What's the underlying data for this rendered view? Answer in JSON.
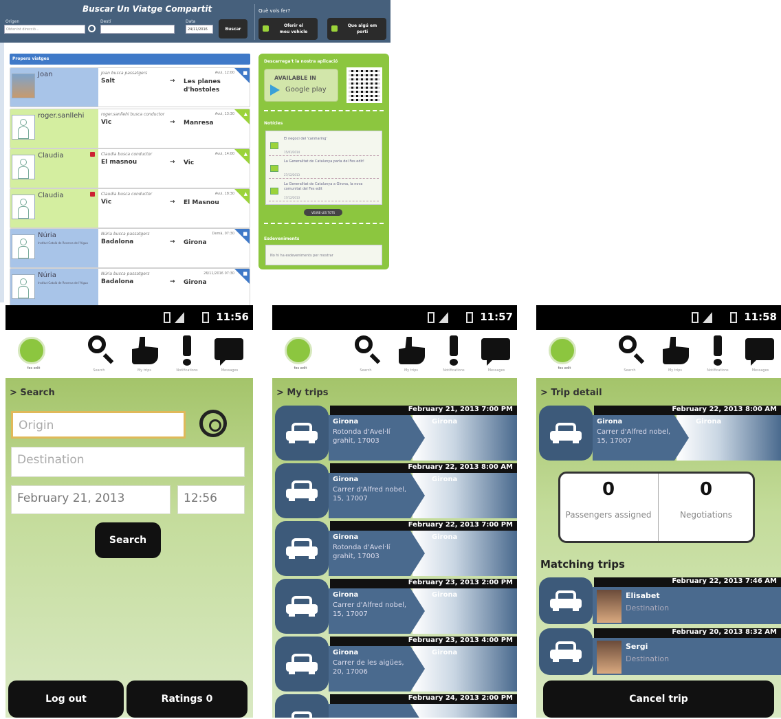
{
  "web": {
    "title": "Buscar Un Viatge Compartit",
    "origin_label": "Origen",
    "origin_placeholder": "Obtenint direcció...",
    "dest_label": "Destí",
    "date_label": "Data",
    "date_value": "24/11/2016",
    "search_button": "Buscar",
    "what_label": "Què vols fer?",
    "offer_button": "Oferir el meu vehicle",
    "want_button": "Que algú em porti",
    "section_title": "Propers viatges",
    "trips": [
      {
        "name": "Joan",
        "org": "",
        "desc": "Joan busca passatgers",
        "when": "Avui, 12:00",
        "from": "Salt",
        "to": "Les planes d'hostoles",
        "color": "blue",
        "badge": false,
        "photo": true
      },
      {
        "name": "roger.sanllehi",
        "org": "",
        "desc": "roger.sanllehi busca conductor",
        "when": "Avui, 13:30",
        "from": "Vic",
        "to": "Manresa",
        "color": "green",
        "badge": false,
        "photo": false
      },
      {
        "name": "Claudia",
        "org": "",
        "desc": "Claudia busca conductor",
        "when": "Avui, 14:00",
        "from": "El masnou",
        "to": "Vic",
        "color": "green",
        "badge": true,
        "photo": false
      },
      {
        "name": "Claudia",
        "org": "",
        "desc": "Claudia busca conductor",
        "when": "Avui, 18:30",
        "from": "Vic",
        "to": "El Masnou",
        "color": "green",
        "badge": true,
        "photo": false
      },
      {
        "name": "Núria",
        "org": "Institut Català de Recerca de l'Aigua",
        "desc": "Núria busca passatgers",
        "when": "Demà, 07:30",
        "from": "Badalona",
        "to": "Girona",
        "color": "blue",
        "badge": false,
        "photo": false
      },
      {
        "name": "Núria",
        "org": "Institut Català de Recerca de l'Aigua",
        "desc": "Núria busca passatgers",
        "when": "26/11/2016 07:30",
        "from": "Badalona",
        "to": "Girona",
        "color": "blue",
        "badge": false,
        "photo": false
      }
    ],
    "arrow": "→",
    "download_title": "Descarrega't la nostra aplicació",
    "gplay_available": "AVAILABLE IN",
    "gplay_name": "Google play",
    "news_title": "Notícies",
    "news": [
      {
        "text": "El negoci del 'carsharing'",
        "date": "15/01/2014"
      },
      {
        "text": "La Generalitat de Catalunya parla del Fes edit!",
        "date": "27/12/2013"
      },
      {
        "text": "La Generalitat de Catalunya a Girona, la nova comunitat del Fes edit",
        "date": "17/12/2013"
      }
    ],
    "see_all": "VEURE-LES TOTS",
    "events_title": "Esdeveniments",
    "events_empty": "No hi ha esdeveniments per mostrar"
  },
  "phones": {
    "logo_label": "fes edit",
    "nav_labels": [
      "Search",
      "My trips",
      "Notifications",
      "Messages"
    ],
    "search_screen": {
      "time": "11:56",
      "crumb": "> Search",
      "origin_placeholder": "Origin",
      "destination_placeholder": "Destination",
      "date": "February 21, 2013",
      "hour": "12:56",
      "search_button": "Search",
      "logout_button": "Log out",
      "ratings_button": "Ratings 0"
    },
    "trips_screen": {
      "time": "11:57",
      "crumb": "> My trips",
      "trips": [
        {
          "date": "February 21, 2013 7:00 PM",
          "from": "Girona",
          "addr": "Rotonda d'Avel·lí grahit, 17003",
          "to": "Girona"
        },
        {
          "date": "February 22, 2013 8:00 AM",
          "from": "Girona",
          "addr": "Carrer d'Alfred nobel, 15, 17007",
          "to": "Girona"
        },
        {
          "date": "February 22, 2013 7:00 PM",
          "from": "Girona",
          "addr": "Rotonda d'Avel·lí grahit, 17003",
          "to": "Girona"
        },
        {
          "date": "February 23, 2013 2:00 PM",
          "from": "Girona",
          "addr": "Carrer d'Alfred nobel, 15, 17007",
          "to": "Girona"
        },
        {
          "date": "February 23, 2013 4:00 PM",
          "from": "Girona",
          "addr": "Carrer de les aigües, 20, 17006",
          "to": "Girona"
        },
        {
          "date": "February 24, 2013 2:00 PM",
          "from": "",
          "addr": "",
          "to": ""
        }
      ]
    },
    "detail_screen": {
      "time": "11:58",
      "crumb": "> Trip detail",
      "trip": {
        "date": "February 22, 2013 8:00 AM",
        "from": "Girona",
        "addr": "Carrer d'Alfred nobel, 15, 17007",
        "to": "Girona"
      },
      "passengers_value": "0",
      "passengers_label": "Passengers assigned",
      "negotiations_value": "0",
      "negotiations_label": "Negotiations",
      "matching_title": "Matching trips",
      "matches": [
        {
          "date": "February 22, 2013 7:46 AM",
          "name": "Elisabet",
          "dest": "Destination"
        },
        {
          "date": "February 20, 2013 8:32 AM",
          "name": "Sergi",
          "dest": "Destination"
        }
      ],
      "cancel_button": "Cancel trip"
    }
  },
  "colors": {
    "web_header": "#46607c",
    "web_blue": "#3f79c8",
    "web_green": "#8cc63f",
    "app_blue": "#4a6a8e"
  }
}
